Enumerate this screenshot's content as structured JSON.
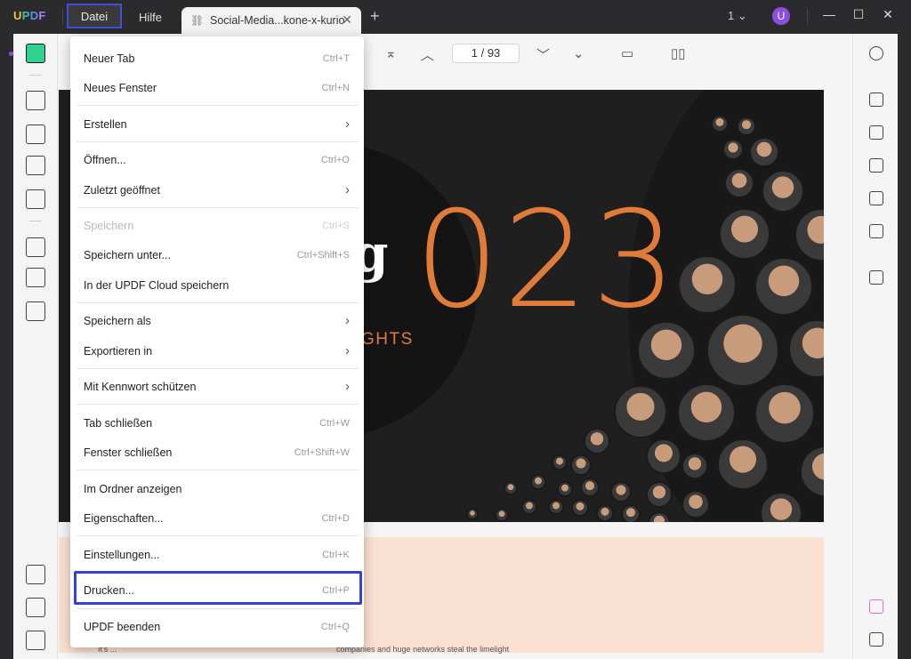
{
  "app": {
    "logo_text": "UPDF",
    "menus": [
      "Datei",
      "Hilfe"
    ],
    "tab_title": "Social-Media...kone-x-kurio",
    "page_count_indicator": "1",
    "avatar_letter": "U"
  },
  "toolbar": {
    "page_current": "1",
    "page_separator": "/",
    "page_total": "93"
  },
  "document": {
    "year_text": "023",
    "g_text": "g",
    "subtitle_text": "GHTS",
    "footer_text_left": "It's ...",
    "footer_text_right": "companies and huge networks steal the limelight"
  },
  "file_menu": {
    "items": [
      {
        "label": "Neuer Tab",
        "shortcut": "Ctrl+T"
      },
      {
        "label": "Neues Fenster",
        "shortcut": "Ctrl+N"
      },
      {
        "label": "Erstellen",
        "submenu": true
      },
      {
        "label": "Öffnen...",
        "shortcut": "Ctrl+O"
      },
      {
        "label": "Zuletzt geöffnet",
        "submenu": true
      },
      {
        "label": "Speichern",
        "shortcut": "Ctrl+S",
        "disabled": true
      },
      {
        "label": "Speichern unter...",
        "shortcut": "Ctrl+Shift+S"
      },
      {
        "label": "In der UPDF Cloud speichern"
      },
      {
        "label": "Speichern als",
        "submenu": true
      },
      {
        "label": "Exportieren in",
        "submenu": true
      },
      {
        "label": "Mit Kennwort schützen",
        "submenu": true
      },
      {
        "label": "Tab schließen",
        "shortcut": "Ctrl+W"
      },
      {
        "label": "Fenster schließen",
        "shortcut": "Ctrl+Shift+W"
      },
      {
        "label": "Im Ordner anzeigen"
      },
      {
        "label": "Eigenschaften...",
        "shortcut": "Ctrl+D"
      },
      {
        "label": "Einstellungen...",
        "shortcut": "Ctrl+K"
      },
      {
        "label": "Drucken...",
        "shortcut": "Ctrl+P",
        "highlighted": true
      },
      {
        "label": "UPDF beenden",
        "shortcut": "Ctrl+Q"
      }
    ],
    "chevron_glyph": "›"
  },
  "colors": {
    "accent_highlight": "#3540d8",
    "year_orange": "#e07b3a",
    "active_tool_green": "#2fd28f",
    "avatar_purple": "#8a4fe0"
  }
}
